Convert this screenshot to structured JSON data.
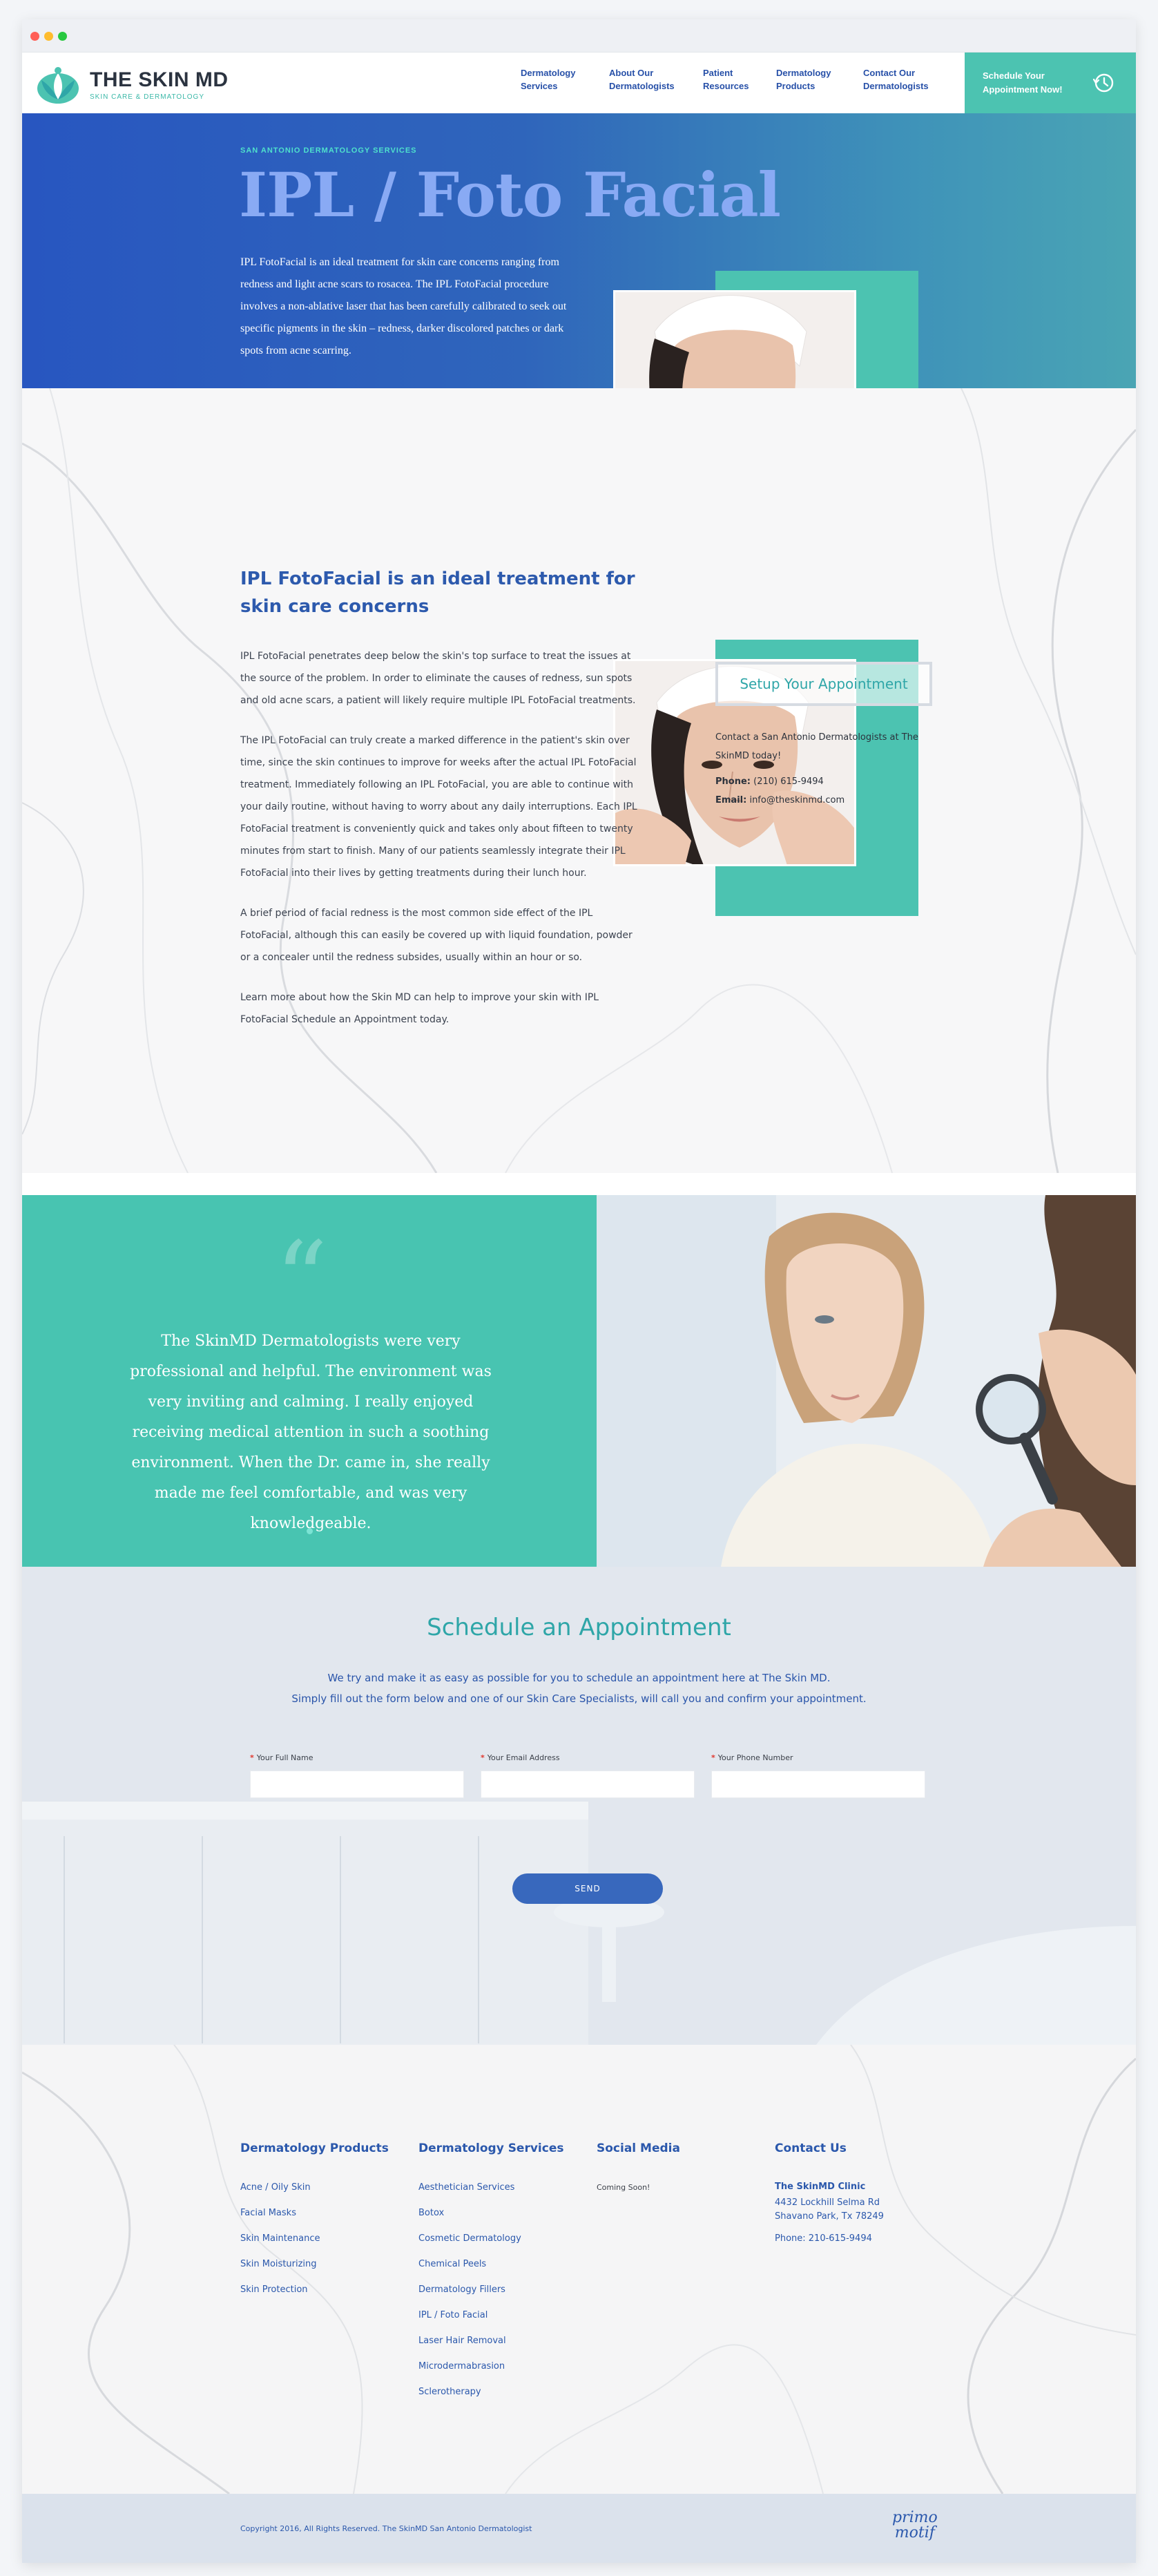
{
  "brand": {
    "title": "THE SKIN MD",
    "subtitle": "SKIN CARE & DERMATOLOGY",
    "teal": "#4cc3b1",
    "blue": "#2856c0"
  },
  "nav": {
    "items": [
      {
        "label": "Dermatology\nServices"
      },
      {
        "label": "About Our\nDermatologists"
      },
      {
        "label": "Patient\nResources"
      },
      {
        "label": "Dermatology\nProducts"
      },
      {
        "label": "Contact Our\nDermatologists"
      }
    ],
    "cta_label": "Schedule Your\nAppointment Now!",
    "cta_icon": "clock-history-icon"
  },
  "hero": {
    "eyebrow": "SAN ANTONIO DERMATOLOGY SERVICES",
    "title": "IPL / Foto Facial",
    "text": "IPL FotoFacial is an ideal treatment for skin care concerns ranging from redness and light acne scars to rosacea. The IPL FotoFacial procedure involves a non-ablative laser that has been carefully calibrated to seek out specific pigments in the skin – redness, darker discolored patches or dark spots from acne scarring."
  },
  "content": {
    "title": "IPL FotoFacial is an ideal treatment for skin care concerns",
    "paragraphs": [
      "IPL FotoFacial penetrates deep below the skin's top surface to treat the issues at the source of the problem. In order to eliminate the causes of redness, sun spots and old acne scars, a patient will likely require multiple IPL FotoFacial treatments.",
      "The IPL FotoFacial can truly create a marked difference in the patient's skin over time, since the skin continues to improve for weeks after the actual IPL FotoFacial treatment. Immediately following an IPL FotoFacial, you are able to continue with your daily routine, without having to worry about any daily interruptions. Each IPL FotoFacial treatment is conveniently quick and takes only about fifteen to twenty minutes from start to finish. Many of our patients seamlessly integrate their IPL FotoFacial into their lives by getting treatments during their lunch hour.",
      "A brief period of facial redness is the most common side effect of the IPL FotoFacial, although this can easily be covered up with liquid foundation, powder or a concealer until the redness subsides, usually within an hour or so.",
      "Learn more about how the Skin MD can help to improve your skin with IPL FotoFacial Schedule an Appointment today."
    ]
  },
  "sidebar": {
    "button": "Setup Your Appointment",
    "text": "Contact a San Antonio Dermatologists at The SkinMD today!",
    "phone_label": "Phone:",
    "phone": "(210) 615-9494",
    "email_label": "Email:",
    "email": "info@theskinmd.com"
  },
  "testimonial": {
    "quote_mark": "“",
    "text": "The SkinMD Dermatologists were very professional and helpful. The environment was very inviting and calming. I really enjoyed receiving medical attention in such a soothing environment. When the Dr. came in, she really made me feel comfortable, and was very knowledgeable."
  },
  "schedule": {
    "title": "Schedule an Appointment",
    "line1": "We try and make it as easy as possible for you to schedule an appointment here at The Skin MD.",
    "line2": "Simply fill out the form below and one of our Skin Care Specialists, will call you and confirm your appointment.",
    "fields": [
      {
        "label": "Your Full Name",
        "value": ""
      },
      {
        "label": "Your Email Address",
        "value": ""
      },
      {
        "label": "Your Phone Number",
        "value": ""
      }
    ],
    "required_mark": "*",
    "send": "SEND"
  },
  "footer": {
    "products": {
      "title": "Dermatology Products",
      "links": [
        "Acne / Oily Skin",
        "Facial Masks",
        "Skin Maintenance",
        "Skin Moisturizing",
        "Skin Protection"
      ]
    },
    "services": {
      "title": "Dermatology Services",
      "links": [
        "Aesthetician Services",
        "Botox",
        "Cosmetic Dermatology",
        "Chemical Peels",
        "Dermatology Fillers",
        "IPL / Foto Facial",
        "Laser Hair Removal",
        "Microdermabrasion",
        "Sclerotherapy"
      ]
    },
    "social": {
      "title": "Social Media",
      "text": "Coming Soon!"
    },
    "contact": {
      "title": "Contact Us",
      "name": "The SkinMD Clinic",
      "address1": "4432 Lockhill Selma Rd",
      "address2": "Shavano Park, Tx 78249",
      "phone": "Phone: 210-615-9494"
    },
    "copyright": "Copyright 2016, All Rights Reserved. The SkinMD San Antonio Dermatologist",
    "credit_line1": "primo",
    "credit_line2": "motif"
  }
}
